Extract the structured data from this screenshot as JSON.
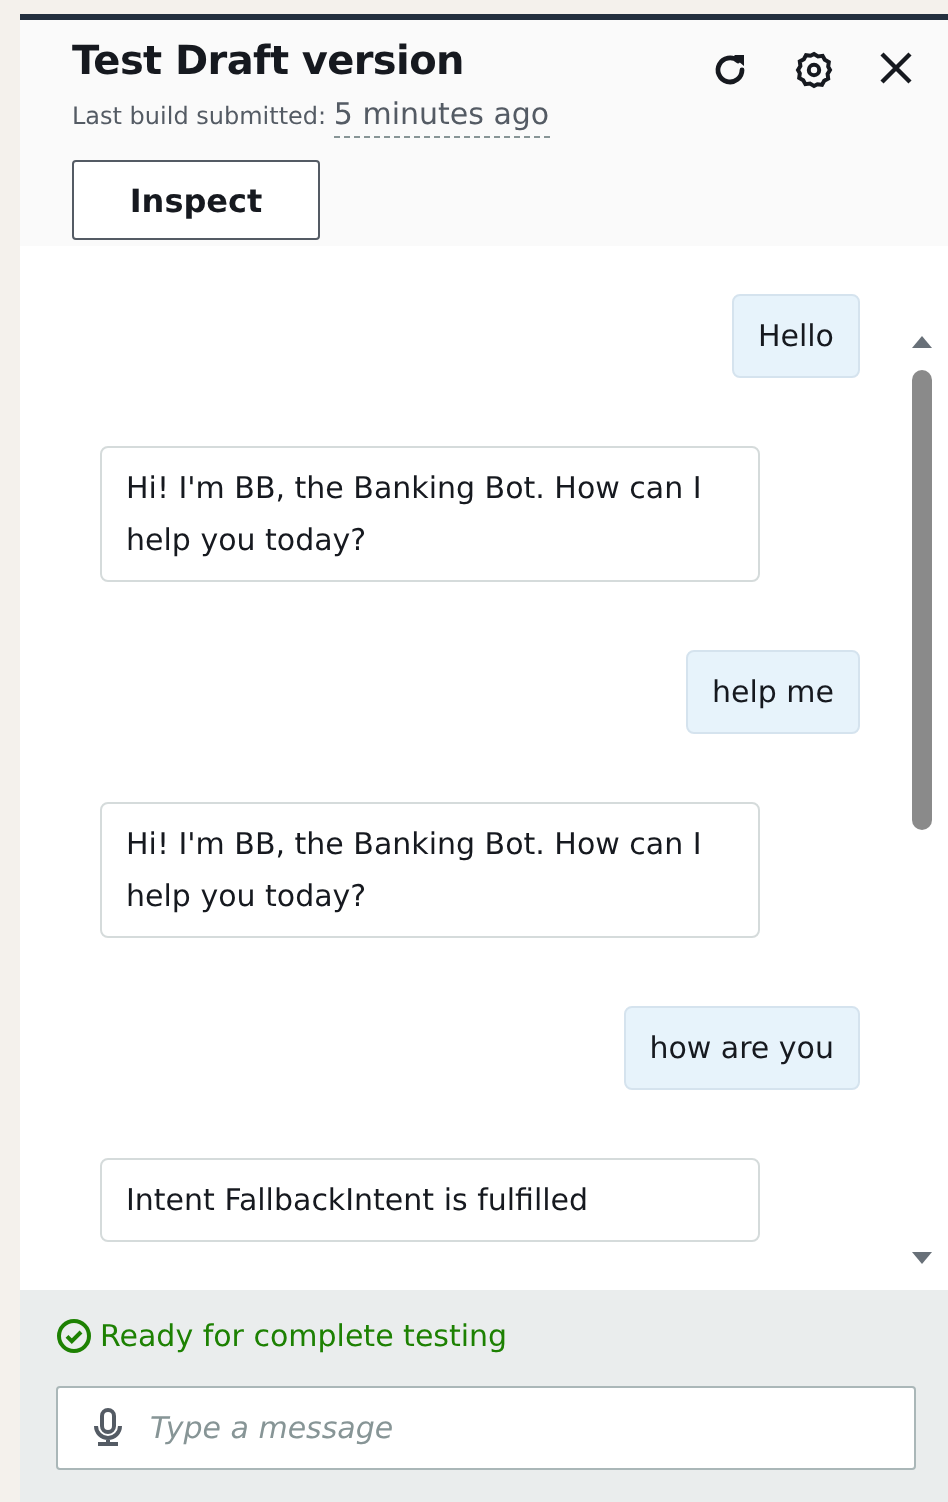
{
  "header": {
    "title": "Test Draft version",
    "build_label": "Last build submitted:",
    "build_time": "5 minutes ago",
    "inspect_button": "Inspect"
  },
  "messages": [
    {
      "kind": "user",
      "text": "Hello"
    },
    {
      "kind": "bot",
      "text": "Hi! I'm BB, the Banking Bot. How can I help you today?"
    },
    {
      "kind": "user",
      "text": "help me"
    },
    {
      "kind": "bot",
      "text": "Hi! I'm BB, the Banking Bot. How can I help you today?"
    },
    {
      "kind": "user",
      "text": "how are you"
    },
    {
      "kind": "bot",
      "text": "Intent FallbackIntent is fulfilled"
    }
  ],
  "status": {
    "text": "Ready for complete testing"
  },
  "input": {
    "placeholder": "Type a message"
  }
}
